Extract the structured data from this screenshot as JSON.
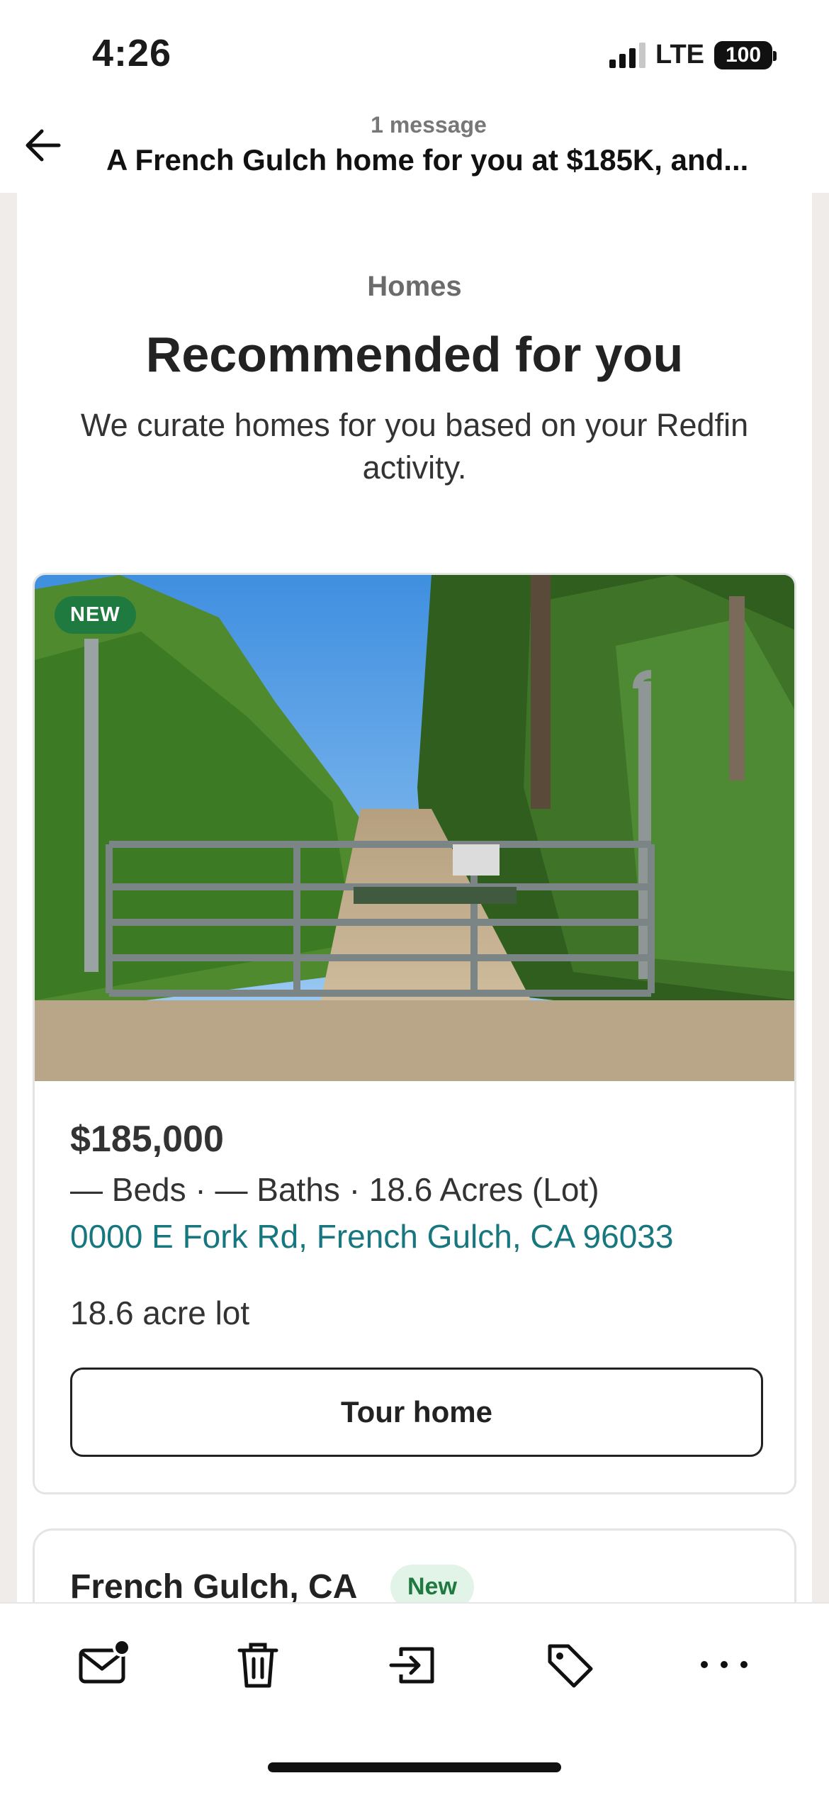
{
  "status_bar": {
    "time": "4:26",
    "network": "LTE",
    "battery": "100"
  },
  "header": {
    "message_count": "1 message",
    "subject": "A French Gulch home for you at $185K, and..."
  },
  "email": {
    "section_tag": "Homes",
    "section_title": "Recommended for you",
    "section_description": "We curate homes for you based on your Redfin activity.",
    "listing": {
      "badge": "NEW",
      "price": "$185,000",
      "stats": "— Beds · — Baths · 18.6 Acres (Lot)",
      "address": "0000 E Fork Rd, French Gulch, CA 96033",
      "description": "18.6 acre lot",
      "tour_button_label": "Tour home"
    },
    "next_card": {
      "title": "French Gulch, CA",
      "badge": "New"
    }
  },
  "toolbar": {
    "icons": [
      "mail-unread-icon",
      "trash-icon",
      "move-icon",
      "tag-icon",
      "more-icon"
    ]
  },
  "colors": {
    "badge_green": "#1f7a40",
    "link_teal": "#17777f",
    "frame_gray": "#efecea"
  }
}
